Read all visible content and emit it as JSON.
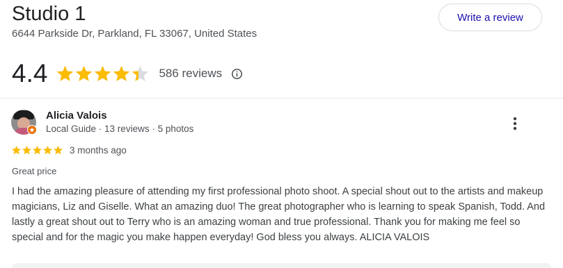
{
  "place": {
    "title": "Studio 1",
    "address": "6644 Parkside Dr, Parkland, FL 33067, United States",
    "rating": "4.4",
    "rating_value": 4.4,
    "reviews_label": "586 reviews",
    "write_review_label": "Write a review"
  },
  "review": {
    "reviewer_name": "Alicia Valois",
    "reviewer_meta": "Local Guide · 13 reviews · 5 photos",
    "stars": 5,
    "time": "3 months ago",
    "tag": "Great price",
    "text": "I had the amazing pleasure of attending my first professional photo shoot. A special shout out to the artists and makeup magicians, Liz and Giselle. What an amazing duo! The great photographer who is learning to speak Spanish, Todd. And lastly a great shout out to Terry who is an amazing woman and true professional. Thank you for making me feel so special and for the magic you make happen everyday! God bless you always. ALICIA VALOIS"
  },
  "icons": {
    "star": "star-icon",
    "info": "info-icon",
    "more": "more-vert-icon",
    "local_guide": "local-guide-badge-icon"
  },
  "colors": {
    "star_gold": "#fbbc04",
    "star_empty": "#dadce0",
    "link_blue": "#1a0dab",
    "badge_orange": "#e8710a"
  }
}
